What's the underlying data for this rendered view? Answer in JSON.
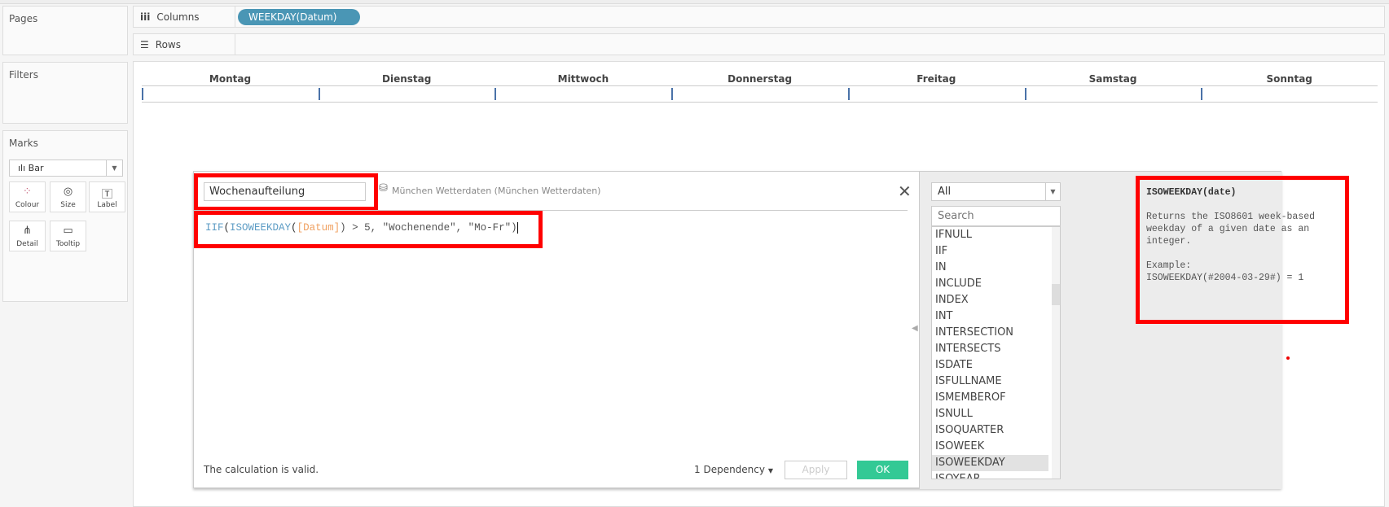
{
  "sidebar": {
    "pages": "Pages",
    "filters": "Filters",
    "marks": "Marks",
    "mark_type": "Bar",
    "mark_buttons": [
      {
        "label": "Colour",
        "icon": "colour-icon"
      },
      {
        "label": "Size",
        "icon": "size-icon"
      },
      {
        "label": "Label",
        "icon": "label-icon"
      },
      {
        "label": "Detail",
        "icon": "detail-icon"
      },
      {
        "label": "Tooltip",
        "icon": "tooltip-icon"
      }
    ]
  },
  "shelves": {
    "columns_label": "Columns",
    "columns_pill": "WEEKDAY(Datum)",
    "rows_label": "Rows"
  },
  "view": {
    "headers": [
      "Montag",
      "Dienstag",
      "Mittwoch",
      "Donnerstag",
      "Freitag",
      "Samstag",
      "Sonntag"
    ]
  },
  "dialog": {
    "calc_name": "Wochenaufteilung",
    "datasource": "München Wetterdaten (München Wetterdaten)",
    "formula": {
      "fn1": "IIF",
      "p1": "(",
      "fn2": "ISOWEEKDAY",
      "p2": "(",
      "field": "[Datum]",
      "rest": ") > 5, \"Wochenende\", \"Mo-Fr\")"
    },
    "status": "The calculation is valid.",
    "dependency": "1 Dependency",
    "apply": "Apply",
    "ok": "OK",
    "category": "All",
    "search_placeholder": "Search",
    "functions": [
      "IFNULL",
      "IIF",
      "IN",
      "INCLUDE",
      "INDEX",
      "INT",
      "INTERSECTION",
      "INTERSECTS",
      "ISDATE",
      "ISFULLNAME",
      "ISMEMBEROF",
      "ISNULL",
      "ISOQUARTER",
      "ISOWEEK",
      "ISOWEEKDAY",
      "ISOYEAR"
    ],
    "selected_function": "ISOWEEKDAY",
    "doc": {
      "signature": "ISOWEEKDAY(date)",
      "description": "Returns the ISO8601 week-based weekday of a given date as an integer.",
      "example_label": "Example:",
      "example": "ISOWEEKDAY(#2004-03-29#) = 1"
    }
  },
  "colors": {
    "accent": "#4a96b5",
    "ok": "#33c995",
    "highlight": "#ff0000"
  }
}
